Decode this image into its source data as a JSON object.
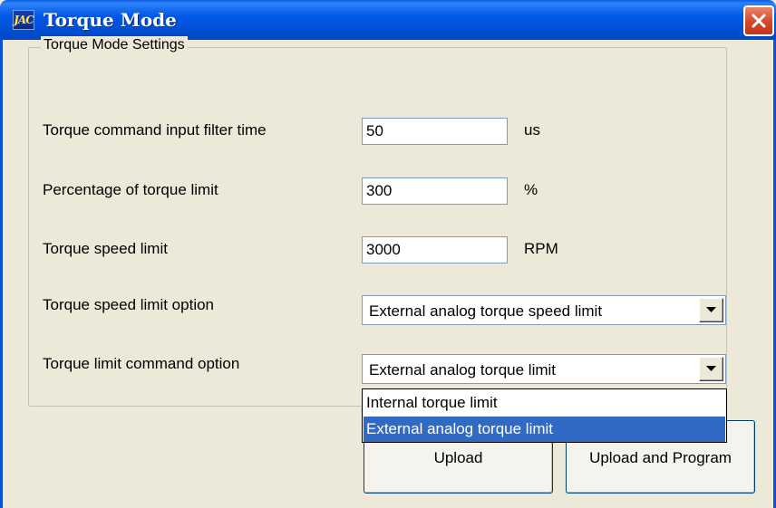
{
  "window": {
    "title": "Torque Mode",
    "icon": "jac-app-icon",
    "icon_text": "JAC"
  },
  "group": {
    "label": "Torque Mode Settings"
  },
  "fields": [
    {
      "label": "Torque command input filter time",
      "value": "50",
      "unit": "us"
    },
    {
      "label": "Percentage of torque limit",
      "value": "300",
      "unit": "%"
    },
    {
      "label": "Torque speed limit",
      "value": "3000",
      "unit": "RPM"
    }
  ],
  "combos": [
    {
      "label": "Torque speed limit option",
      "value": "External analog torque speed limit"
    },
    {
      "label": "Torque limit command option",
      "value": "External analog torque limit"
    }
  ],
  "dropdown": {
    "options": [
      "Internal torque limit",
      "External analog torque limit"
    ],
    "selected_index": 1
  },
  "buttons": {
    "upload": "Upload",
    "upload_program": "Upload and Program"
  },
  "colors": {
    "titlebar": "#0058e6",
    "close": "#d2472a",
    "selection": "#316ac5",
    "window_bg": "#ece9d8"
  }
}
